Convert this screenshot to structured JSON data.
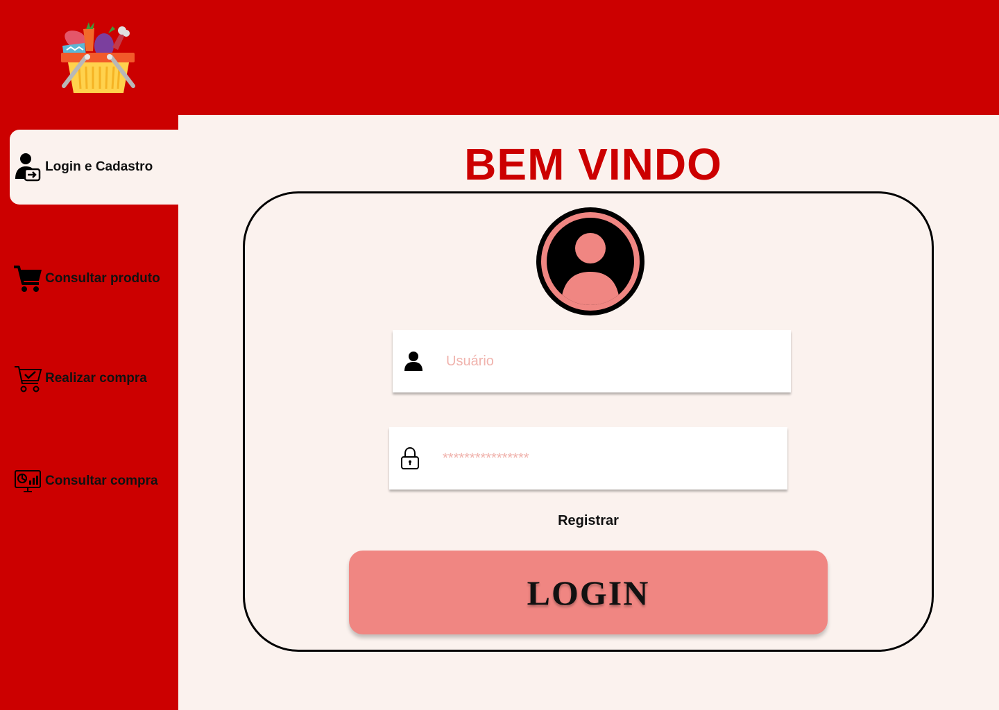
{
  "brand": {
    "logo_icon": "grocery-basket-icon"
  },
  "sidebar": {
    "items": [
      {
        "label": "Login e Cadastro",
        "icon": "user-login-icon",
        "active": true
      },
      {
        "label": "Consultar produto",
        "icon": "shopping-cart-icon",
        "active": false
      },
      {
        "label": "Realizar compra",
        "icon": "cart-check-icon",
        "active": false
      },
      {
        "label": "Consultar compra",
        "icon": "monitor-chart-icon",
        "active": false
      }
    ]
  },
  "main": {
    "title": "BEM VINDO",
    "login_form": {
      "avatar_icon": "user-avatar-icon",
      "username": {
        "placeholder": "Usuário",
        "icon": "user-icon"
      },
      "password": {
        "placeholder": "****************",
        "icon": "lock-icon"
      },
      "register_link": "Registrar",
      "login_button": "LOGIN"
    }
  },
  "colors": {
    "brand_red": "#cc0000",
    "background": "#fbf2ee",
    "button_pink": "#f08682",
    "placeholder": "#f0b3ad"
  }
}
